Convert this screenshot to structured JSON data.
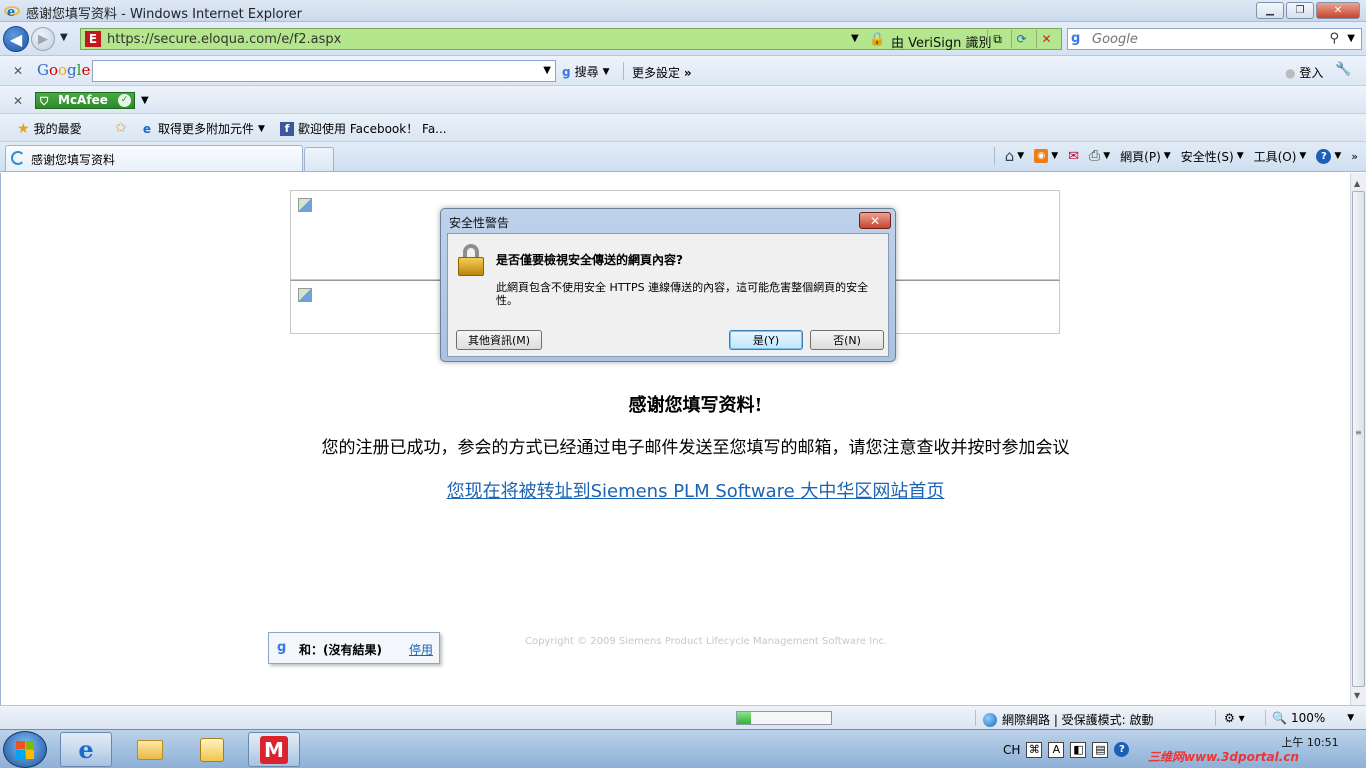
{
  "window": {
    "title": "感谢您填写资料 - Windows Internet Explorer",
    "controls": [
      "minimize",
      "maximize",
      "close"
    ]
  },
  "address_bar": {
    "url": "https://secure.eloqua.com/e/f2.aspx",
    "identity": "由 VeriSign 識別",
    "search_placeholder": "Google"
  },
  "google_toolbar": {
    "search_label": "搜尋",
    "more_label": "更多設定",
    "login_label": "登入"
  },
  "mcafee_toolbar": {
    "brand": "McAfee"
  },
  "favorites_bar": {
    "favorites_label": "我的最愛",
    "items": [
      "取得更多附加元件",
      "歡迎使用 Facebook！ Fa..."
    ]
  },
  "tabs": [
    {
      "title": "感谢您填写资料"
    }
  ],
  "command_bar": {
    "page": "網頁(P)",
    "safety": "安全性(S)",
    "tools": "工具(O)"
  },
  "page": {
    "thanks": "感谢您填写资料!",
    "success": "您的注册已成功，参会的方式已经通过电子邮件发送至您填写的邮箱，请您注意查收并按时参加会议",
    "redirect": "您现在将被转址到Siemens PLM Software 大中华区网站首页",
    "copyright": "Copyright © 2009 Siemens Product Lifecycle Management Software Inc."
  },
  "google_popup": {
    "text": "和：(沒有結果)",
    "disable_link": "停用"
  },
  "dialog": {
    "title": "安全性警告",
    "question": "是否僅要檢視安全傳送的網頁內容?",
    "message": "此網頁包含不使用安全 HTTPS 連線傳送的內容，這可能危害整個網頁的安全性。",
    "more_info": "其他資訊(M)",
    "yes": "是(Y)",
    "no": "否(N)"
  },
  "status_bar": {
    "progress": 0.15,
    "zone": "網際網路 | 受保護模式: 啟動",
    "zoom": "100%"
  },
  "taskbar": {
    "ime": "CH",
    "time": "上午 10:51"
  },
  "watermark": "三维网www.3dportal.cn"
}
